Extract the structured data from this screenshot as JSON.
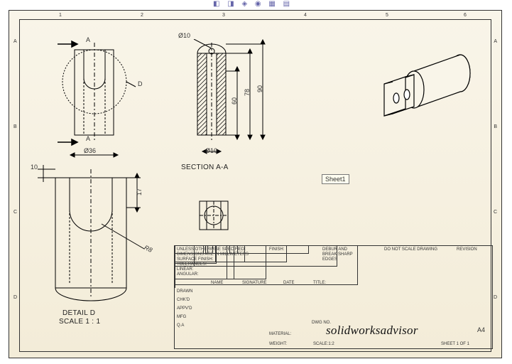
{
  "sheet": {
    "tooltip_label": "Sheet1"
  },
  "zones": {
    "cols": [
      "1",
      "2",
      "3",
      "4",
      "5",
      "6"
    ],
    "rows": [
      "A",
      "B",
      "C",
      "D"
    ]
  },
  "views": {
    "front": {
      "section_markers": [
        "A",
        "A"
      ],
      "detail_circle_label": "D",
      "diameter_label": "Ø36"
    },
    "section": {
      "caption": "SECTION A-A",
      "top_diameter": "Ø10",
      "bottom_diameter": "Ø10",
      "dims": {
        "inner_height": "60",
        "mid_height": "78",
        "outer_height": "90"
      }
    },
    "detail": {
      "caption_line1": "DETAIL D",
      "caption_line2": "SCALE 1 : 1",
      "width_label": "10",
      "depth_label": "17",
      "radius_label": "R8"
    },
    "aux": {
      "label": ""
    },
    "iso": {
      "label": ""
    }
  },
  "titleblock": {
    "notes_line1": "UNLESS OTHERWISE SPECIFIED:",
    "notes_line2": "DIMENSIONS ARE IN MILLIMETERS",
    "notes_line3": "SURFACE FINISH:",
    "notes_line4": "TOLERANCES:",
    "notes_line5": "  LINEAR:",
    "notes_line6": "  ANGULAR:",
    "col_name": "NAME",
    "col_signature": "SIGNATURE",
    "col_date": "DATE",
    "rows": [
      "DRAWN",
      "CHK'D",
      "APPV'D",
      "MFG",
      "Q.A"
    ],
    "finish": "FINISH:",
    "debur": "DEBUR AND",
    "debur2": "BREAK SHARP",
    "debur3": "EDGES",
    "do_not_scale": "DO NOT SCALE DRAWING",
    "revision": "REVISION",
    "material": "MATERIAL:",
    "weight": "WEIGHT:",
    "dwg_no_label": "DWG NO.",
    "brand": "solidworksadvisor",
    "scale": "SCALE:1:2",
    "sheet": "SHEET 1 OF 1",
    "format": "A4",
    "title_label": "TITLE:"
  }
}
